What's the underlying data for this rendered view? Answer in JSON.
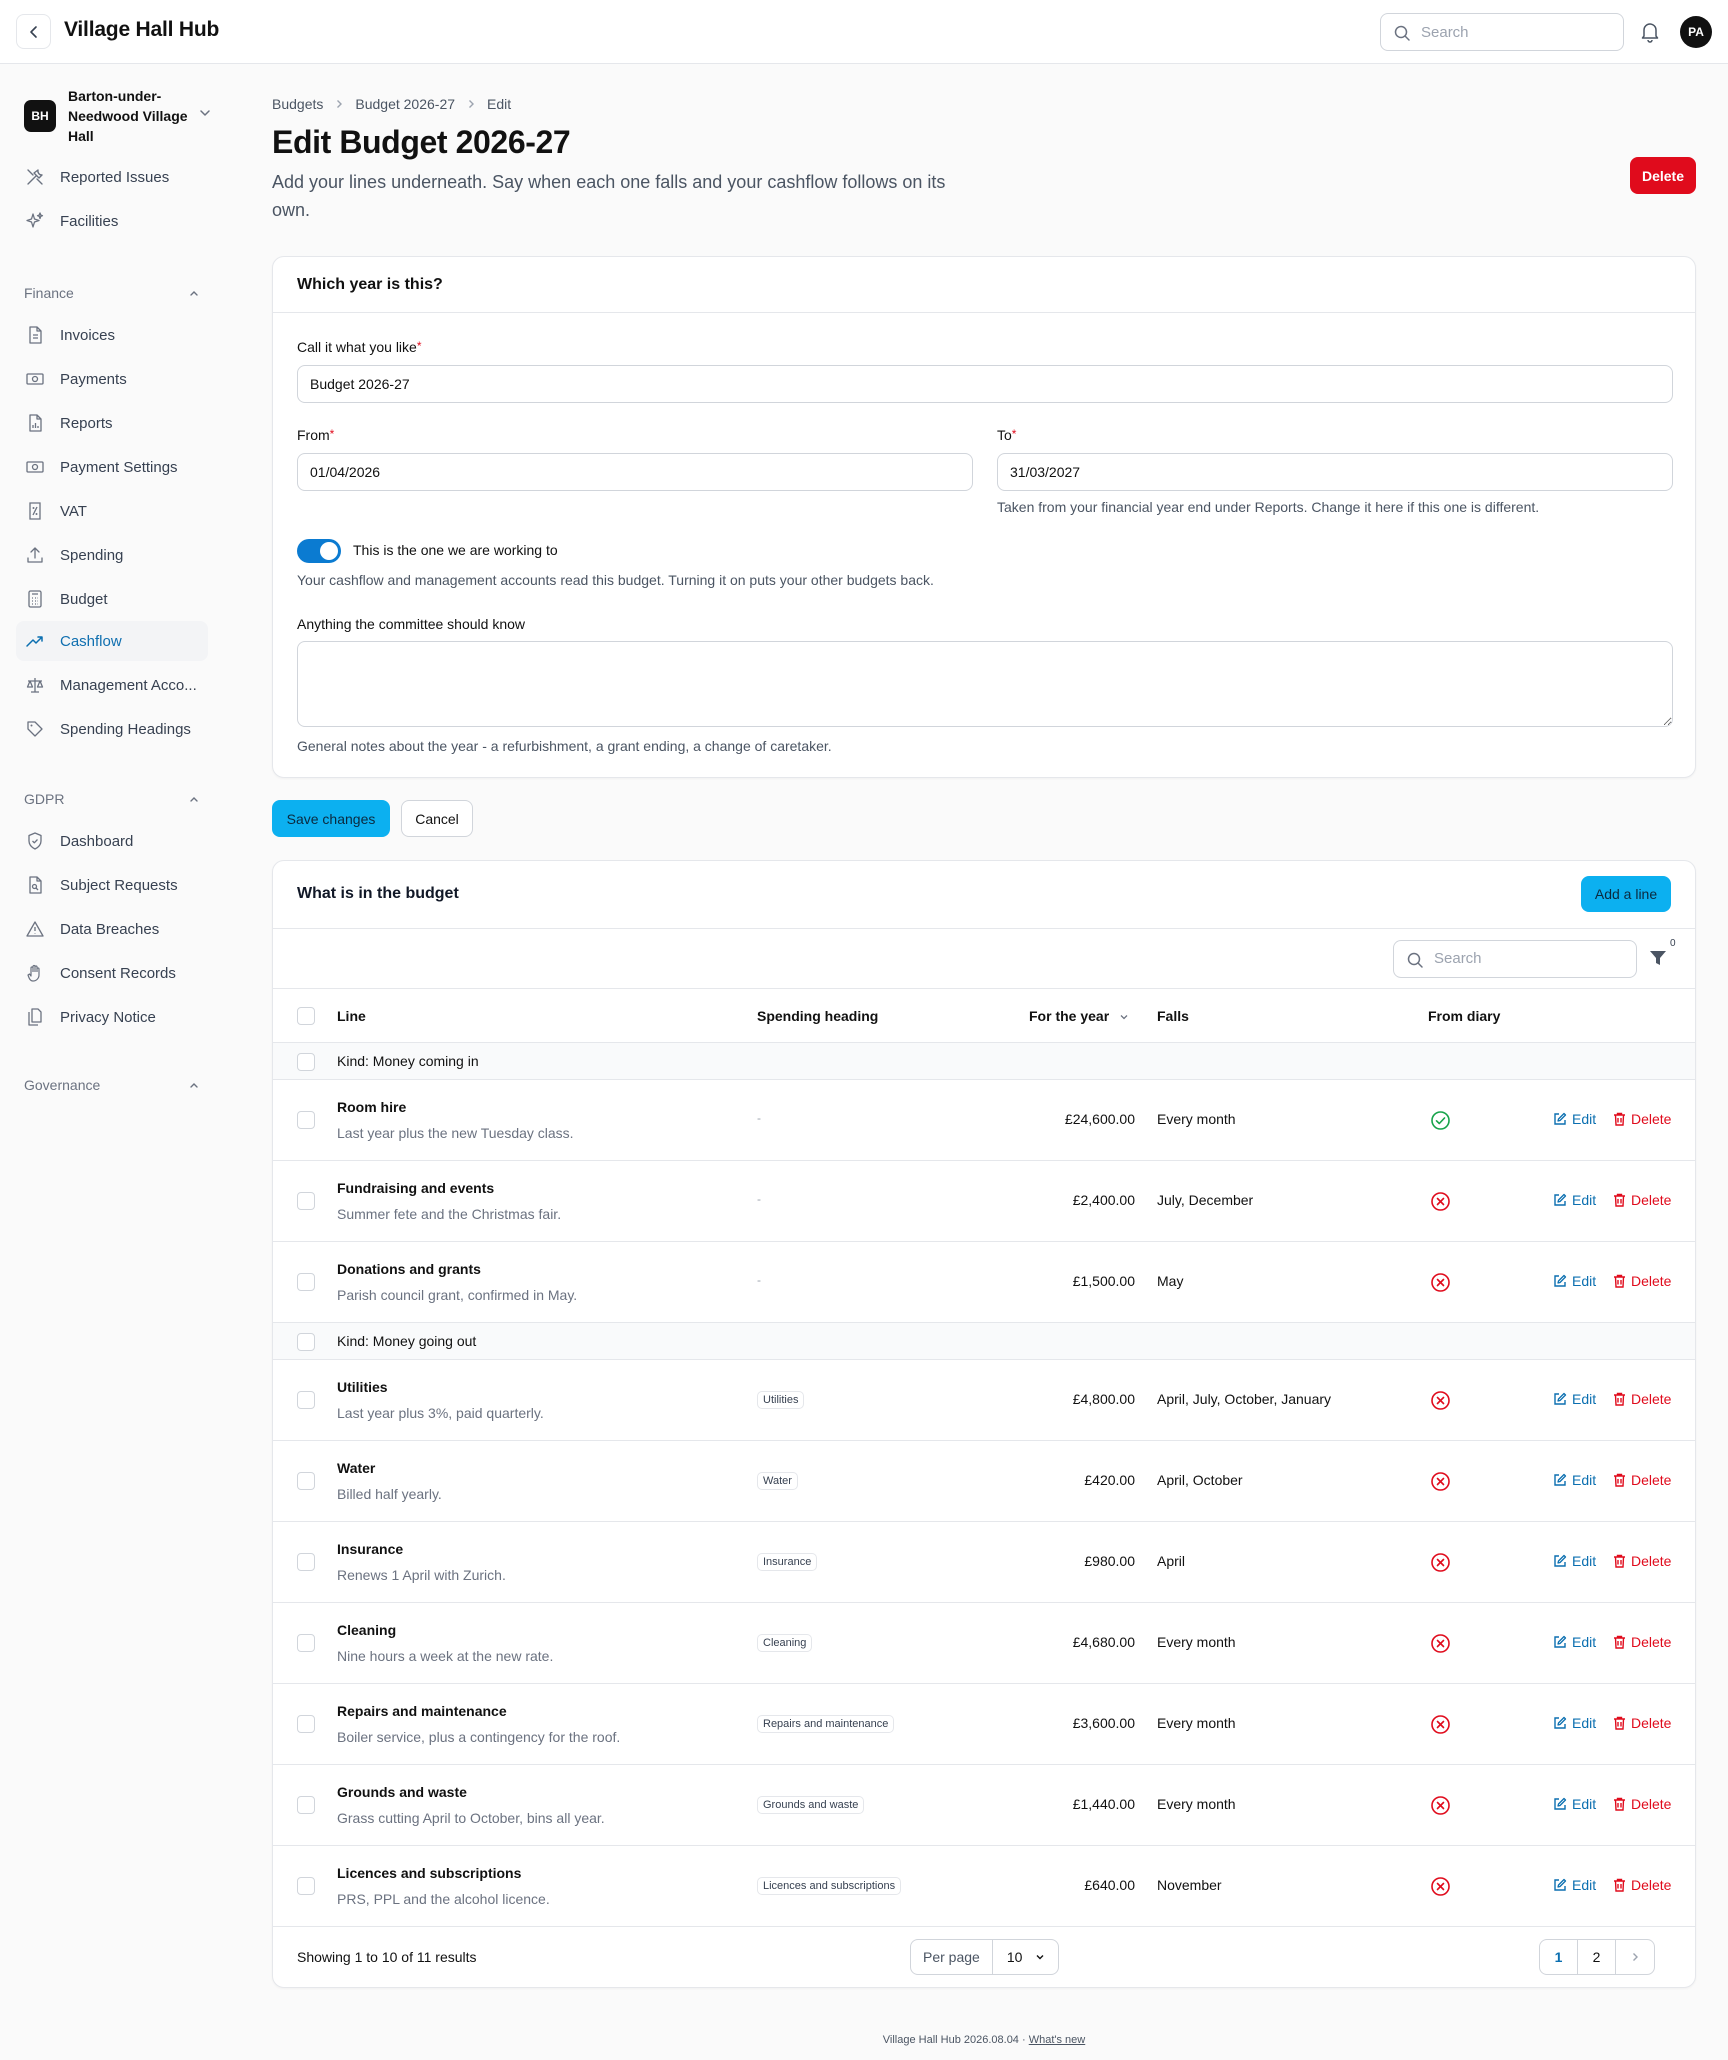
{
  "app": {
    "title": "Village Hall Hub",
    "search_placeholder": "Search",
    "avatar_initials": "PA"
  },
  "org": {
    "initials": "BH",
    "name": "Barton-under-Needwood Village Hall"
  },
  "sidebar": {
    "top_items": [
      {
        "label": "Reported Issues",
        "icon": "tools-icon"
      },
      {
        "label": "Facilities",
        "icon": "sparkles-icon"
      }
    ],
    "finance": {
      "label": "Finance",
      "items": [
        {
          "label": "Invoices",
          "icon": "document-icon"
        },
        {
          "label": "Payments",
          "icon": "banknote-icon"
        },
        {
          "label": "Reports",
          "icon": "report-icon"
        },
        {
          "label": "Payment Settings",
          "icon": "banknote-icon"
        },
        {
          "label": "VAT",
          "icon": "percent-icon"
        },
        {
          "label": "Spending",
          "icon": "upload-icon"
        },
        {
          "label": "Budget",
          "icon": "calculator-icon"
        },
        {
          "label": "Cashflow",
          "icon": "trending-up-icon",
          "active": true
        },
        {
          "label": "Management Acco...",
          "icon": "scale-icon"
        },
        {
          "label": "Spending Headings",
          "icon": "tag-icon"
        }
      ]
    },
    "gdpr": {
      "label": "GDPR",
      "items": [
        {
          "label": "Dashboard",
          "icon": "shield-icon"
        },
        {
          "label": "Subject Requests",
          "icon": "document-search-icon"
        },
        {
          "label": "Data Breaches",
          "icon": "warning-icon"
        },
        {
          "label": "Consent Records",
          "icon": "hand-icon"
        },
        {
          "label": "Privacy Notice",
          "icon": "documents-icon"
        }
      ]
    },
    "governance": {
      "label": "Governance"
    }
  },
  "breadcrumb": [
    "Budgets",
    "Budget 2026-27",
    "Edit"
  ],
  "page": {
    "title": "Edit Budget 2026-27",
    "subtitle": "Add your lines underneath. Say when each one falls and your cashflow follows on its own.",
    "delete_label": "Delete"
  },
  "form": {
    "section_title": "Which year is this?",
    "name_label": "Call it what you like",
    "name_value": "Budget 2026-27",
    "from_label": "From",
    "from_value": "01/04/2026",
    "to_label": "To",
    "to_value": "31/03/2027",
    "to_help": "Taken from your financial year end under Reports. Change it here if this one is different.",
    "toggle_on": true,
    "toggle_label": "This is the one we are working to",
    "toggle_help": "Your cashflow and management accounts read this budget. Turning it on puts your other budgets back.",
    "notes_label": "Anything the committee should know",
    "notes_value": "",
    "notes_help": "General notes about the year - a refurbishment, a grant ending, a change of caretaker.",
    "save_label": "Save changes",
    "cancel_label": "Cancel"
  },
  "table": {
    "title": "What is in the budget",
    "add_label": "Add a line",
    "search_placeholder": "Search",
    "filter_count": "0",
    "columns": {
      "line": "Line",
      "heading": "Spending heading",
      "amount": "For the year",
      "falls": "Falls",
      "diary": "From diary"
    },
    "edit_label": "Edit",
    "delete_label": "Delete",
    "groups": [
      {
        "label": "Kind: Money coming in",
        "rows": [
          {
            "name": "Room hire",
            "desc": "Last year plus the new Tuesday class.",
            "heading": "-",
            "amount": "£24,600.00",
            "falls": "Every month",
            "from_diary": true
          },
          {
            "name": "Fundraising and events",
            "desc": "Summer fete and the Christmas fair.",
            "heading": "-",
            "amount": "£2,400.00",
            "falls": "July, December",
            "from_diary": false
          },
          {
            "name": "Donations and grants",
            "desc": "Parish council grant, confirmed in May.",
            "heading": "-",
            "amount": "£1,500.00",
            "falls": "May",
            "from_diary": false
          }
        ]
      },
      {
        "label": "Kind: Money going out",
        "rows": [
          {
            "name": "Utilities",
            "desc": "Last year plus 3%, paid quarterly.",
            "heading": "Utilities",
            "amount": "£4,800.00",
            "falls": "April, July, October, January",
            "from_diary": false
          },
          {
            "name": "Water",
            "desc": "Billed half yearly.",
            "heading": "Water",
            "amount": "£420.00",
            "falls": "April, October",
            "from_diary": false
          },
          {
            "name": "Insurance",
            "desc": "Renews 1 April with Zurich.",
            "heading": "Insurance",
            "amount": "£980.00",
            "falls": "April",
            "from_diary": false
          },
          {
            "name": "Cleaning",
            "desc": "Nine hours a week at the new rate.",
            "heading": "Cleaning",
            "amount": "£4,680.00",
            "falls": "Every month",
            "from_diary": false
          },
          {
            "name": "Repairs and maintenance",
            "desc": "Boiler service, plus a contingency for the roof.",
            "heading": "Repairs and maintenance",
            "amount": "£3,600.00",
            "falls": "Every month",
            "from_diary": false
          },
          {
            "name": "Grounds and waste",
            "desc": "Grass cutting April to October, bins all year.",
            "heading": "Grounds and waste",
            "amount": "£1,440.00",
            "falls": "Every month",
            "from_diary": false
          },
          {
            "name": "Licences and subscriptions",
            "desc": "PRS, PPL and the alcohol licence.",
            "heading": "Licences and subscriptions",
            "amount": "£640.00",
            "falls": "November",
            "from_diary": false
          }
        ]
      }
    ],
    "footer": {
      "showing": "Showing 1 to 10 of 11 results",
      "per_page_label": "Per page",
      "per_page_value": "10",
      "pages": [
        "1",
        "2"
      ],
      "current_page": "1"
    }
  },
  "footer": {
    "version": "Village Hall Hub 2026.08.04 ·",
    "link": "What's new"
  },
  "colors": {
    "accent": "#0cb0f0",
    "link": "#0b6fb0",
    "danger": "#e00b1c",
    "success": "#16a34a"
  }
}
